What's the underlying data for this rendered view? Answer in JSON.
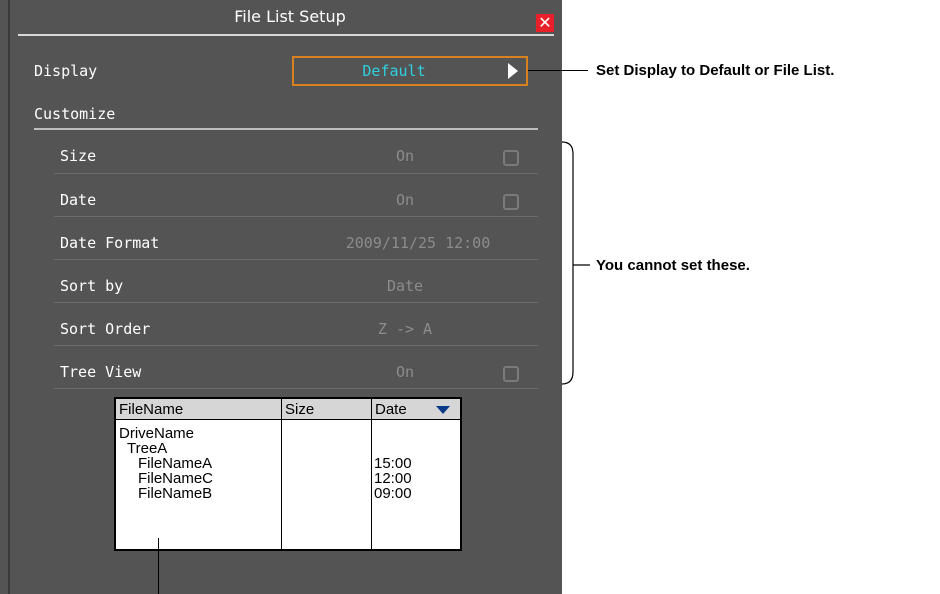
{
  "dialog": {
    "title": "File List Setup",
    "display_label": "Display",
    "display_value": "Default",
    "customize_label": "Customize",
    "rows": [
      {
        "label": "Size",
        "value": "On",
        "checkbox": true
      },
      {
        "label": "Date",
        "value": "On",
        "checkbox": true
      },
      {
        "label": "Date Format",
        "value": "2009/11/25 12:00",
        "checkbox": false
      },
      {
        "label": "Sort by",
        "value": "Date",
        "checkbox": false
      },
      {
        "label": "Sort Order",
        "value": "Z -> A",
        "checkbox": false
      },
      {
        "label": "Tree View",
        "value": "On",
        "checkbox": true
      }
    ]
  },
  "preview": {
    "columns": [
      "FileName",
      "Size",
      "Date"
    ],
    "names": [
      "DriveName",
      "TreeA",
      "FileNameA",
      "FileNameC",
      "FileNameB"
    ],
    "dates": [
      "15:00",
      "12:00",
      "09:00"
    ]
  },
  "annotations": {
    "display_note": "Set Display to Default or File List.",
    "disabled_note": "You cannot set these."
  },
  "colors": {
    "background": "#545454",
    "accent_border": "#d7821f",
    "value_text": "#2ed0e0",
    "close": "#e8202a",
    "disabled_text": "#8c8c8c"
  }
}
